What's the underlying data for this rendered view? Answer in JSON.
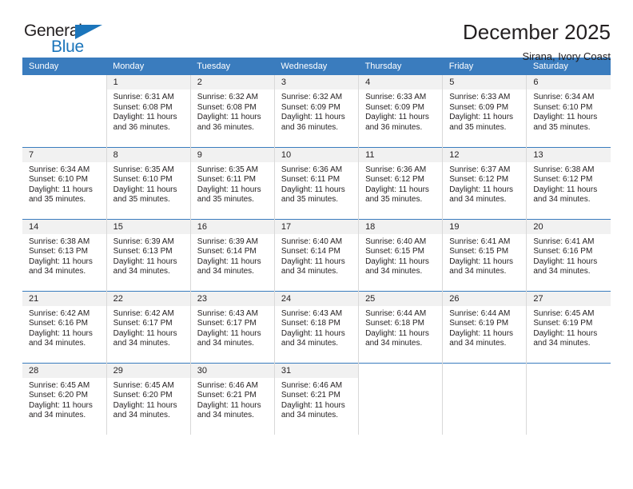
{
  "brand": {
    "name_part1": "General",
    "name_part2": "Blue",
    "triangle_color": "#1b75bb"
  },
  "header": {
    "title": "December 2025",
    "subtitle": "Sirana, Ivory Coast"
  },
  "theme": {
    "header_bar": "#3a7cbe",
    "daynum_band": "#f1f1f1",
    "text": "#231f20"
  },
  "weekdays": [
    "Sunday",
    "Monday",
    "Tuesday",
    "Wednesday",
    "Thursday",
    "Friday",
    "Saturday"
  ],
  "weeks": [
    [
      {
        "day": "",
        "sunrise": "",
        "sunset": "",
        "daylight_line1": "",
        "daylight_line2": ""
      },
      {
        "day": "1",
        "sunrise": "Sunrise: 6:31 AM",
        "sunset": "Sunset: 6:08 PM",
        "daylight_line1": "Daylight: 11 hours",
        "daylight_line2": "and 36 minutes."
      },
      {
        "day": "2",
        "sunrise": "Sunrise: 6:32 AM",
        "sunset": "Sunset: 6:08 PM",
        "daylight_line1": "Daylight: 11 hours",
        "daylight_line2": "and 36 minutes."
      },
      {
        "day": "3",
        "sunrise": "Sunrise: 6:32 AM",
        "sunset": "Sunset: 6:09 PM",
        "daylight_line1": "Daylight: 11 hours",
        "daylight_line2": "and 36 minutes."
      },
      {
        "day": "4",
        "sunrise": "Sunrise: 6:33 AM",
        "sunset": "Sunset: 6:09 PM",
        "daylight_line1": "Daylight: 11 hours",
        "daylight_line2": "and 36 minutes."
      },
      {
        "day": "5",
        "sunrise": "Sunrise: 6:33 AM",
        "sunset": "Sunset: 6:09 PM",
        "daylight_line1": "Daylight: 11 hours",
        "daylight_line2": "and 35 minutes."
      },
      {
        "day": "6",
        "sunrise": "Sunrise: 6:34 AM",
        "sunset": "Sunset: 6:10 PM",
        "daylight_line1": "Daylight: 11 hours",
        "daylight_line2": "and 35 minutes."
      }
    ],
    [
      {
        "day": "7",
        "sunrise": "Sunrise: 6:34 AM",
        "sunset": "Sunset: 6:10 PM",
        "daylight_line1": "Daylight: 11 hours",
        "daylight_line2": "and 35 minutes."
      },
      {
        "day": "8",
        "sunrise": "Sunrise: 6:35 AM",
        "sunset": "Sunset: 6:10 PM",
        "daylight_line1": "Daylight: 11 hours",
        "daylight_line2": "and 35 minutes."
      },
      {
        "day": "9",
        "sunrise": "Sunrise: 6:35 AM",
        "sunset": "Sunset: 6:11 PM",
        "daylight_line1": "Daylight: 11 hours",
        "daylight_line2": "and 35 minutes."
      },
      {
        "day": "10",
        "sunrise": "Sunrise: 6:36 AM",
        "sunset": "Sunset: 6:11 PM",
        "daylight_line1": "Daylight: 11 hours",
        "daylight_line2": "and 35 minutes."
      },
      {
        "day": "11",
        "sunrise": "Sunrise: 6:36 AM",
        "sunset": "Sunset: 6:12 PM",
        "daylight_line1": "Daylight: 11 hours",
        "daylight_line2": "and 35 minutes."
      },
      {
        "day": "12",
        "sunrise": "Sunrise: 6:37 AM",
        "sunset": "Sunset: 6:12 PM",
        "daylight_line1": "Daylight: 11 hours",
        "daylight_line2": "and 34 minutes."
      },
      {
        "day": "13",
        "sunrise": "Sunrise: 6:38 AM",
        "sunset": "Sunset: 6:12 PM",
        "daylight_line1": "Daylight: 11 hours",
        "daylight_line2": "and 34 minutes."
      }
    ],
    [
      {
        "day": "14",
        "sunrise": "Sunrise: 6:38 AM",
        "sunset": "Sunset: 6:13 PM",
        "daylight_line1": "Daylight: 11 hours",
        "daylight_line2": "and 34 minutes."
      },
      {
        "day": "15",
        "sunrise": "Sunrise: 6:39 AM",
        "sunset": "Sunset: 6:13 PM",
        "daylight_line1": "Daylight: 11 hours",
        "daylight_line2": "and 34 minutes."
      },
      {
        "day": "16",
        "sunrise": "Sunrise: 6:39 AM",
        "sunset": "Sunset: 6:14 PM",
        "daylight_line1": "Daylight: 11 hours",
        "daylight_line2": "and 34 minutes."
      },
      {
        "day": "17",
        "sunrise": "Sunrise: 6:40 AM",
        "sunset": "Sunset: 6:14 PM",
        "daylight_line1": "Daylight: 11 hours",
        "daylight_line2": "and 34 minutes."
      },
      {
        "day": "18",
        "sunrise": "Sunrise: 6:40 AM",
        "sunset": "Sunset: 6:15 PM",
        "daylight_line1": "Daylight: 11 hours",
        "daylight_line2": "and 34 minutes."
      },
      {
        "day": "19",
        "sunrise": "Sunrise: 6:41 AM",
        "sunset": "Sunset: 6:15 PM",
        "daylight_line1": "Daylight: 11 hours",
        "daylight_line2": "and 34 minutes."
      },
      {
        "day": "20",
        "sunrise": "Sunrise: 6:41 AM",
        "sunset": "Sunset: 6:16 PM",
        "daylight_line1": "Daylight: 11 hours",
        "daylight_line2": "and 34 minutes."
      }
    ],
    [
      {
        "day": "21",
        "sunrise": "Sunrise: 6:42 AM",
        "sunset": "Sunset: 6:16 PM",
        "daylight_line1": "Daylight: 11 hours",
        "daylight_line2": "and 34 minutes."
      },
      {
        "day": "22",
        "sunrise": "Sunrise: 6:42 AM",
        "sunset": "Sunset: 6:17 PM",
        "daylight_line1": "Daylight: 11 hours",
        "daylight_line2": "and 34 minutes."
      },
      {
        "day": "23",
        "sunrise": "Sunrise: 6:43 AM",
        "sunset": "Sunset: 6:17 PM",
        "daylight_line1": "Daylight: 11 hours",
        "daylight_line2": "and 34 minutes."
      },
      {
        "day": "24",
        "sunrise": "Sunrise: 6:43 AM",
        "sunset": "Sunset: 6:18 PM",
        "daylight_line1": "Daylight: 11 hours",
        "daylight_line2": "and 34 minutes."
      },
      {
        "day": "25",
        "sunrise": "Sunrise: 6:44 AM",
        "sunset": "Sunset: 6:18 PM",
        "daylight_line1": "Daylight: 11 hours",
        "daylight_line2": "and 34 minutes."
      },
      {
        "day": "26",
        "sunrise": "Sunrise: 6:44 AM",
        "sunset": "Sunset: 6:19 PM",
        "daylight_line1": "Daylight: 11 hours",
        "daylight_line2": "and 34 minutes."
      },
      {
        "day": "27",
        "sunrise": "Sunrise: 6:45 AM",
        "sunset": "Sunset: 6:19 PM",
        "daylight_line1": "Daylight: 11 hours",
        "daylight_line2": "and 34 minutes."
      }
    ],
    [
      {
        "day": "28",
        "sunrise": "Sunrise: 6:45 AM",
        "sunset": "Sunset: 6:20 PM",
        "daylight_line1": "Daylight: 11 hours",
        "daylight_line2": "and 34 minutes."
      },
      {
        "day": "29",
        "sunrise": "Sunrise: 6:45 AM",
        "sunset": "Sunset: 6:20 PM",
        "daylight_line1": "Daylight: 11 hours",
        "daylight_line2": "and 34 minutes."
      },
      {
        "day": "30",
        "sunrise": "Sunrise: 6:46 AM",
        "sunset": "Sunset: 6:21 PM",
        "daylight_line1": "Daylight: 11 hours",
        "daylight_line2": "and 34 minutes."
      },
      {
        "day": "31",
        "sunrise": "Sunrise: 6:46 AM",
        "sunset": "Sunset: 6:21 PM",
        "daylight_line1": "Daylight: 11 hours",
        "daylight_line2": "and 34 minutes."
      },
      {
        "day": "",
        "sunrise": "",
        "sunset": "",
        "daylight_line1": "",
        "daylight_line2": ""
      },
      {
        "day": "",
        "sunrise": "",
        "sunset": "",
        "daylight_line1": "",
        "daylight_line2": ""
      },
      {
        "day": "",
        "sunrise": "",
        "sunset": "",
        "daylight_line1": "",
        "daylight_line2": ""
      }
    ]
  ]
}
